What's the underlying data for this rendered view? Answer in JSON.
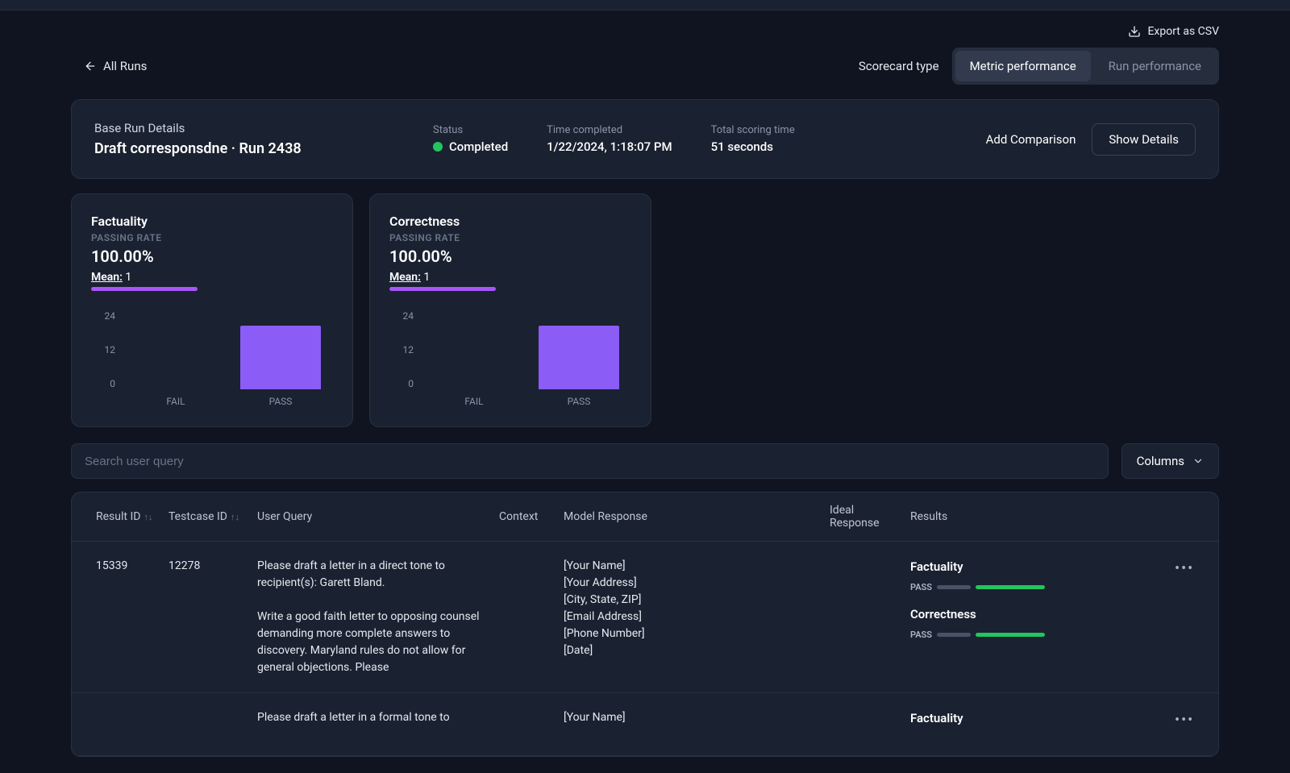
{
  "export_label": "Export as CSV",
  "back_label": "All Runs",
  "scorecard": {
    "label": "Scorecard type",
    "tabs": [
      "Metric performance",
      "Run performance"
    ],
    "active": 0
  },
  "details": {
    "heading": "Base Run Details",
    "title": "Draft corresponsdne · Run 2438",
    "status_label": "Status",
    "status_value": "Completed",
    "time_label": "Time completed",
    "time_value": "1/22/2024, 1:18:07 PM",
    "scoring_label": "Total scoring time",
    "scoring_value": "51 seconds",
    "add_comparison": "Add Comparison",
    "show_details": "Show Details"
  },
  "metrics": [
    {
      "title": "Factuality",
      "sublabel": "PASSING RATE",
      "rate": "100.00%",
      "mean_label": "Mean:",
      "mean_value": "1",
      "mean_bar_pct": 44
    },
    {
      "title": "Correctness",
      "sublabel": "PASSING RATE",
      "rate": "100.00%",
      "mean_label": "Mean:",
      "mean_value": "1",
      "mean_bar_pct": 44
    }
  ],
  "chart_data": [
    {
      "type": "bar",
      "title": "Factuality",
      "categories": [
        "FAIL",
        "PASS"
      ],
      "values": [
        0,
        24
      ],
      "y_ticks": [
        0,
        12,
        24
      ],
      "ylim": [
        0,
        28
      ]
    },
    {
      "type": "bar",
      "title": "Correctness",
      "categories": [
        "FAIL",
        "PASS"
      ],
      "values": [
        0,
        24
      ],
      "y_ticks": [
        0,
        12,
        24
      ],
      "ylim": [
        0,
        28
      ]
    }
  ],
  "search": {
    "placeholder": "Search user query"
  },
  "columns_btn": "Columns",
  "table": {
    "headers": {
      "result_id": "Result ID",
      "testcase_id": "Testcase ID",
      "user_query": "User Query",
      "context": "Context",
      "model_response": "Model Response",
      "ideal_response": "Ideal Response",
      "results": "Results"
    },
    "rows": [
      {
        "result_id": "15339",
        "testcase_id": "12278",
        "user_query": "Please draft a letter in a direct tone to recipient(s): Garett Bland.\n\nWrite a good faith letter to opposing counsel demanding more complete answers to discovery. Maryland rules do not allow for general objections. Please",
        "context": "",
        "model_response": "[Your Name]\n[Your Address]\n[City, State, ZIP]\n[Email Address]\n[Phone Number]\n[Date]",
        "ideal_response": "",
        "results": [
          {
            "name": "Factuality",
            "status": "PASS"
          },
          {
            "name": "Correctness",
            "status": "PASS"
          }
        ]
      },
      {
        "result_id": "",
        "testcase_id": "",
        "user_query": "Please draft a letter in a formal tone to",
        "context": "",
        "model_response": "[Your Name]",
        "ideal_response": "",
        "results": [
          {
            "name": "Factuality",
            "status": ""
          }
        ]
      }
    ]
  }
}
